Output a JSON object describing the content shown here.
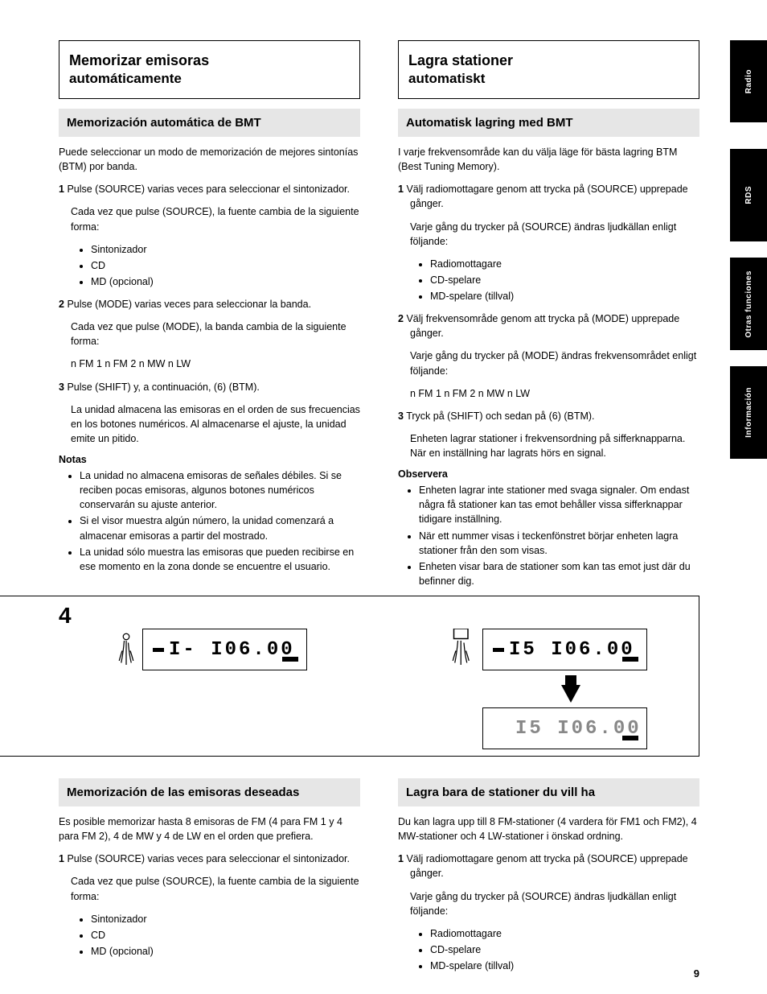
{
  "left": {
    "title_box": {
      "line1": "Memorizar emisoras",
      "line2": "automáticamente"
    },
    "sub1": "Memorización automática de BMT",
    "intro": "Puede seleccionar un modo de memorización de mejores sintonías (BTM) por banda.",
    "step1_label": "1",
    "step1": "Pulse (SOURCE) varias veces para seleccionar el sintonizador.",
    "step1_desc": "Cada vez que pulse (SOURCE), la fuente cambia de la siguiente forma:",
    "src_bullets": [
      "Sintonizador",
      "CD",
      "MD (opcional)"
    ],
    "step2_label": "2",
    "step2": "Pulse (MODE) varias veces para seleccionar la banda.",
    "step2_desc": "Cada vez que pulse (MODE), la banda cambia de la siguiente forma:",
    "step2_seq": "n FM 1 n FM 2 n MW n LW",
    "step3_label": "3",
    "step3": "Pulse (SHIFT) y, a continuación, (6) (BTM).",
    "step3_desc": "La unidad almacena las emisoras en el orden de sus frecuencias en los botones numéricos. Al almacenarse el ajuste, la unidad emite un pitido.",
    "notes_label": "Notas",
    "notes": [
      "La unidad no almacena emisoras de señales débiles. Si se reciben pocas emisoras, algunos botones numéricos conservarán su ajuste anterior.",
      "Si el visor muestra algún número, la unidad comenzará a almacenar emisoras a partir del mostrado.",
      "La unidad sólo muestra las emisoras que pueden recibirse en ese momento en la zona donde se encuentre el usuario."
    ],
    "sub2": "Memorización de las emisoras deseadas",
    "sub2_intro": "Es posible memorizar hasta 8 emisoras de FM (4 para FM 1 y 4 para FM 2), 4 de MW y 4 de LW en el orden que prefiera.",
    "l_step1_label": "1",
    "l_step1": "Pulse (SOURCE) varias veces para seleccionar el sintonizador.",
    "l_step1_desc": "Cada vez que pulse (SOURCE), la fuente cambia de la siguiente forma:",
    "l_src_bullets": [
      "Sintonizador",
      "CD",
      "MD (opcional)"
    ]
  },
  "right": {
    "title_box": {
      "line1": "Lagra stationer",
      "line2": "automatiskt"
    },
    "sub1": "Automatisk lagring med BMT",
    "intro": "I varje frekvensområde kan du välja läge för bästa lagring BTM (Best Tuning Memory).",
    "step1_label": "1",
    "step1": "Välj radiomottagare genom att trycka på (SOURCE) upprepade gånger.",
    "step1_desc": "Varje gång du trycker på (SOURCE) ändras ljudkällan enligt följande:",
    "src_bullets": [
      "Radiomottagare",
      "CD-spelare",
      "MD-spelare (tillval)"
    ],
    "step2_label": "2",
    "step2": "Välj frekvensområde genom att trycka på (MODE) upprepade gånger.",
    "step2_desc": "Varje gång du trycker på (MODE) ändras frekvensområdet enligt följande:",
    "step2_seq": "n FM 1 n FM 2 n MW n LW",
    "step3_label": "3",
    "step3": "Tryck på (SHIFT) och sedan på (6) (BTM).",
    "step3_desc": "Enheten lagrar stationer i frekvensordning på sifferknapparna. När en inställning har lagrats hörs en signal.",
    "notes_label": "Observera",
    "notes": [
      "Enheten lagrar inte stationer med svaga signaler. Om endast några få stationer kan tas emot behåller vissa sifferknappar tidigare inställning.",
      "När ett nummer visas i teckenfönstret börjar enheten lagra stationer från den som visas.",
      "Enheten visar bara de stationer som kan tas emot just där du befinner dig."
    ],
    "sub2": "Lagra bara de stationer du vill ha",
    "sub2_intro": "Du kan lagra upp till 8 FM-stationer (4 vardera för FM1 och FM2), 4 MW-stationer och 4 LW-stationer i önskad ordning.",
    "r_step1_label": "1",
    "r_step1": "Välj radiomottagare genom att trycka på (SOURCE) upprepade gånger.",
    "r_step1_desc": "Varje gång du trycker på (SOURCE) ändras ljudkällan enligt följande:",
    "r_src_bullets": [
      "Radiomottagare",
      "CD-spelare",
      "MD-spelare (tillval)"
    ]
  },
  "illustration": {
    "step_num": "4",
    "lcd1": "I-  I06.00",
    "lcd2": "I5  I06.00",
    "lcd3": "I5  I06.00"
  },
  "tabs": {
    "t1": "Radio",
    "t2": "RDS",
    "t3": "Otras funciones",
    "t4": "Información"
  },
  "page_number": "9"
}
